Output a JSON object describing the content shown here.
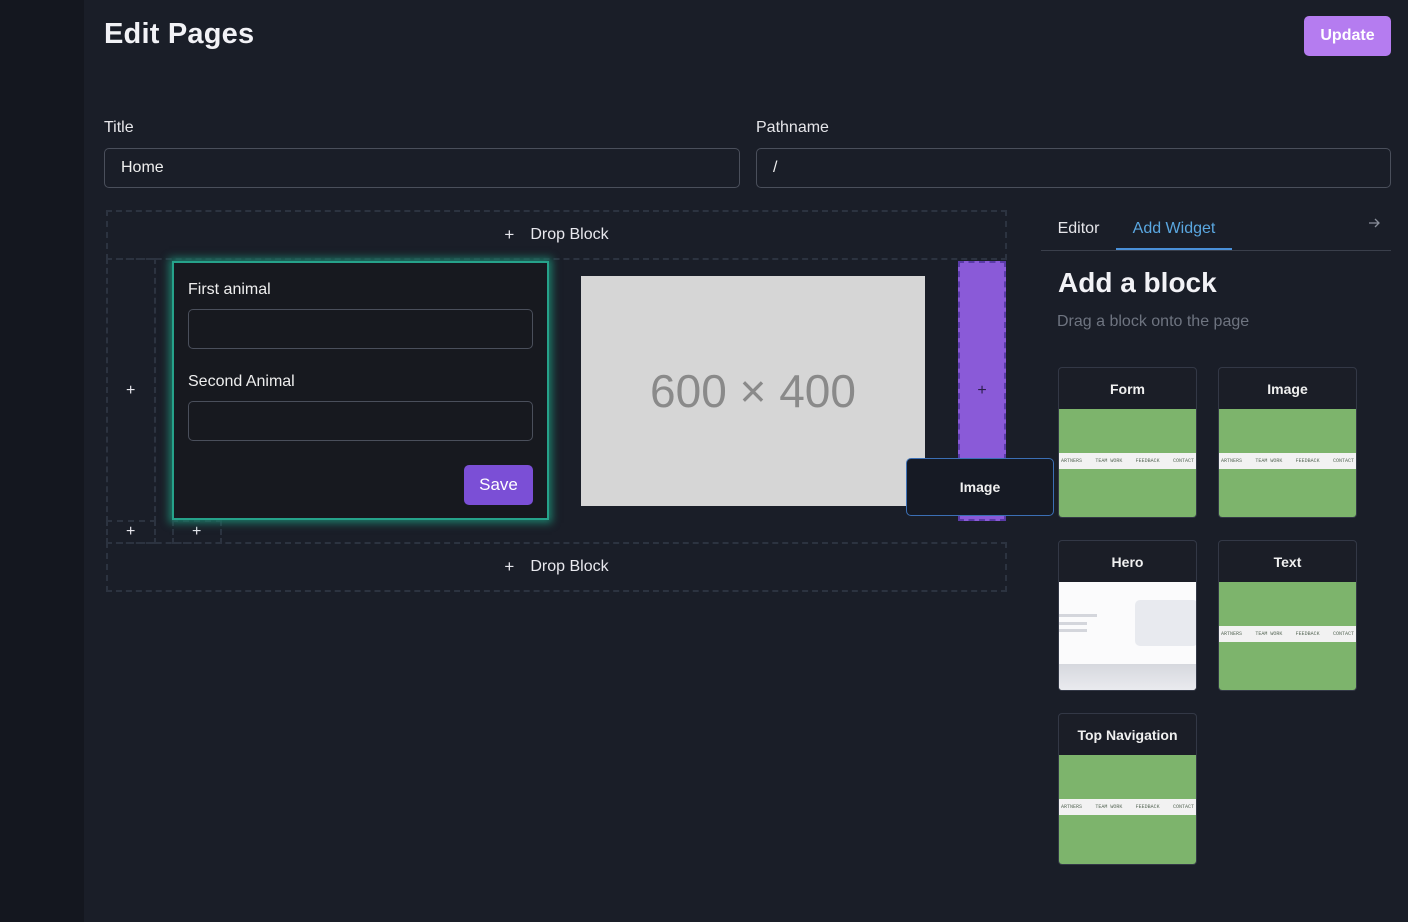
{
  "header": {
    "title": "Edit Pages",
    "update_label": "Update"
  },
  "fields": {
    "title": {
      "label": "Title",
      "value": "Home"
    },
    "pathname": {
      "label": "Pathname",
      "value": "/"
    }
  },
  "canvas": {
    "drop_block_label": "Drop Block",
    "plus": "+",
    "form_block": {
      "field1_label": "First animal",
      "field2_label": "Second Animal",
      "save_label": "Save"
    },
    "image_placeholder": "600 × 400",
    "drag_ghost_label": "Image"
  },
  "sidebar": {
    "tabs": [
      {
        "label": "Editor"
      },
      {
        "label": "Add Widget"
      }
    ],
    "active_tab": "Add Widget",
    "title": "Add a block",
    "subtitle": "Drag a block onto the page",
    "blocks": [
      {
        "label": "Form"
      },
      {
        "label": "Image"
      },
      {
        "label": "Hero"
      },
      {
        "label": "Text"
      },
      {
        "label": "Top Navigation"
      }
    ],
    "thumb_nav_items": [
      "ARTNERS",
      "TEAM WORK",
      "FEEDBACK",
      "CONTACT"
    ]
  },
  "colors": {
    "accent_purple": "#b57cf0",
    "save_purple": "#7b4fd6",
    "selection_teal": "#26a28a",
    "tab_active_blue": "#5aa7e0",
    "thumb_green": "#7db46c"
  }
}
